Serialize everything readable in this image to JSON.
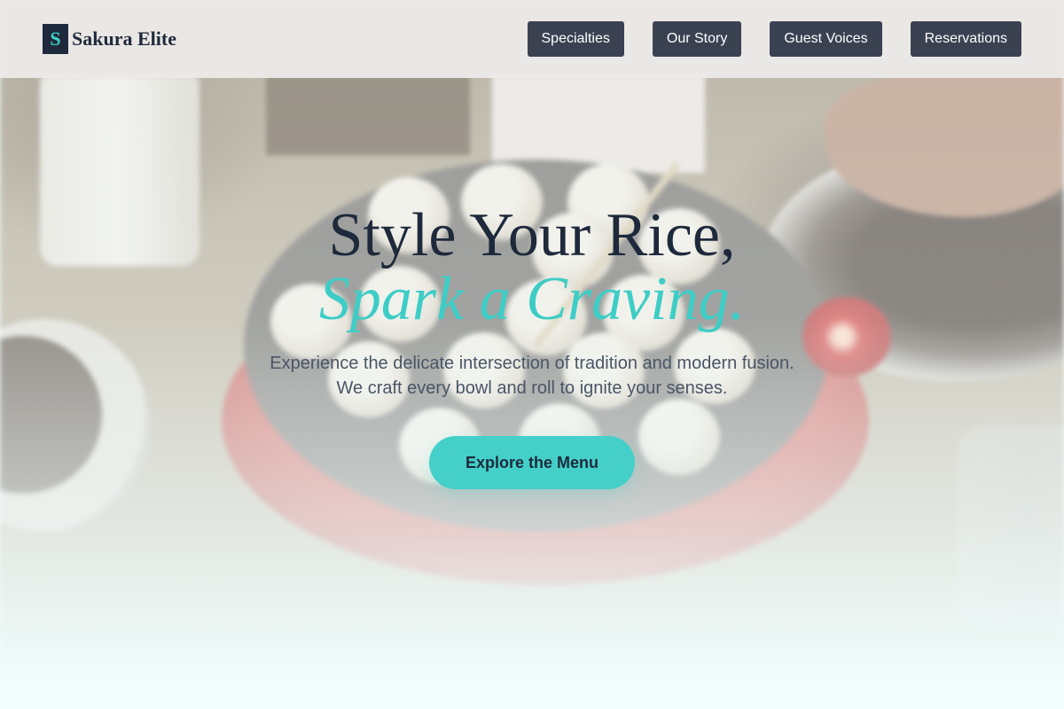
{
  "brand": {
    "mark": "S",
    "name": "Sakura Elite"
  },
  "nav": {
    "items": [
      {
        "label": "Specialties"
      },
      {
        "label": "Our Story"
      },
      {
        "label": "Guest Voices"
      },
      {
        "label": "Reservations"
      }
    ]
  },
  "hero": {
    "title": "Style Your Rice,",
    "subtitle": "Spark a Craving.",
    "text_line1": "Experience the delicate intersection of tradition and modern fusion.",
    "text_line2": "We craft every bowl and roll to ignite your senses.",
    "cta_label": "Explore the Menu"
  },
  "colors": {
    "brand_dark": "#1e2a3b",
    "accent_teal": "#44d0c9",
    "nav_button_bg": "#3a4252",
    "header_bg": "#eeecea"
  }
}
